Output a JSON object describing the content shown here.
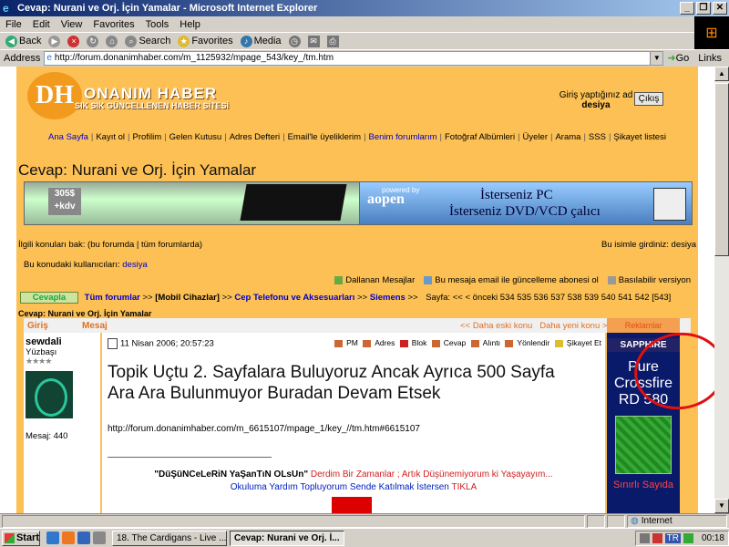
{
  "window": {
    "title": "Cevap: Nurani ve Orj. İçin Yamalar - Microsoft Internet Explorer",
    "buttons": [
      "_",
      "❐",
      "✕"
    ]
  },
  "menu": [
    "File",
    "Edit",
    "View",
    "Favorites",
    "Tools",
    "Help"
  ],
  "toolbar": {
    "back": "Back",
    "search": "Search",
    "favorites": "Favorites",
    "media": "Media"
  },
  "address": {
    "label": "Address",
    "url": "http://forum.donanimhaber.com/m_1125932/mpage_543/key_/tm.htm",
    "go": "Go",
    "links": "Links"
  },
  "site": {
    "logo": "DH",
    "brand": "ONANIM HABER",
    "tagline": "SIK SIK GÜNCELLENEN HABER SİTESİ",
    "login_text": "Giriş yaptığınız ad",
    "username": "desiya",
    "logout": "Çıkış",
    "nav": [
      "Ana Sayfa",
      "Kayıt ol",
      "Profilim",
      "Gelen Kutusu",
      "Adres Defteri",
      "Email'le üyeliklerim",
      "Benim forumlarım",
      "Fotoğraf Albümleri",
      "Üyeler",
      "Arama",
      "SSS",
      "Şikayet listesi"
    ],
    "page_title": "Cevap: Nurani ve Orj. İçin Yamalar",
    "banner_left_price": "305$ +kdv",
    "banner_right": {
      "powered": "powered by",
      "brand": "aopen",
      "line1": "İsterseniz PC",
      "line2": "İsterseniz DVD/VCD çalıcı"
    },
    "related": "İlgili konuları bak: (bu forumda | tüm forumlarda)",
    "entered_as": "Bu isimle girdiniz: desiya",
    "users_label": "Bu konudaki kullanıcıları:",
    "users_value": "desiya",
    "actions": [
      "Dallanan Mesajlar",
      "Bu mesaja email ile güncelleme abonesi ol",
      "Basılabilir versiyon"
    ],
    "reply_button": "Cevapla",
    "crumbs": [
      "Tüm forumlar",
      "[Mobil Cihazlar]",
      "Cep Telefonu ve Aksesuarları",
      "Siemens"
    ],
    "pager": "Sayfa: <<  < önceki  534 535 536 537 538 539 540 541 542 [543]",
    "current_title": "Cevap: Nurani ve Orj. İçin Yamalar",
    "col_author": "Giriş",
    "col_message": "Mesaj",
    "nav_older": "<< Daha eski konu",
    "nav_newer": "Daha yeni konu >>",
    "ads_label": "Reklamlar"
  },
  "post": {
    "author": "sewdali",
    "rank": "Yüzbaşı",
    "stars": "★★★★",
    "message_count": "Mesaj: 440",
    "date": "11 Nisan 2006; 20:57:23",
    "tools": [
      "PM",
      "Adres",
      "Blok",
      "Cevap",
      "Alıntı",
      "Yönlendir",
      "Şikayet Et"
    ],
    "body": "Topik Uçtu 2. Sayfalara Buluyoruz Ancak Ayrıca 500 Sayfa Ara Ara Bulunmuyor Buradan Devam Etsek",
    "link": "http://forum.donanimhaber.com/m_6615107/mpage_1/key_//tm.htm#6615107",
    "sig_bold": "\"DüŞüNCeLeRiN YaŞanTıN OLsUn\"",
    "sig_red": "Derdim Bir Zamanlar ; Artık Düşünemiyorum ki Yaşayayım...",
    "sig2": "Okuluma Yardım Topluyorum Sende Katılmak İstersen",
    "sig2_link": "TIKLA"
  },
  "ad": {
    "brand": "SAPPHIRE",
    "text": "Pure Crossfire RD 580",
    "sub": "Sınırlı Sayıda"
  },
  "status": {
    "zone": "Internet"
  },
  "taskbar": {
    "start": "Start",
    "tasks": [
      "18. The Cardigans - Live ...",
      "Cevap: Nurani ve Orj. İ..."
    ],
    "clock": "00:18",
    "lang": "TR"
  }
}
